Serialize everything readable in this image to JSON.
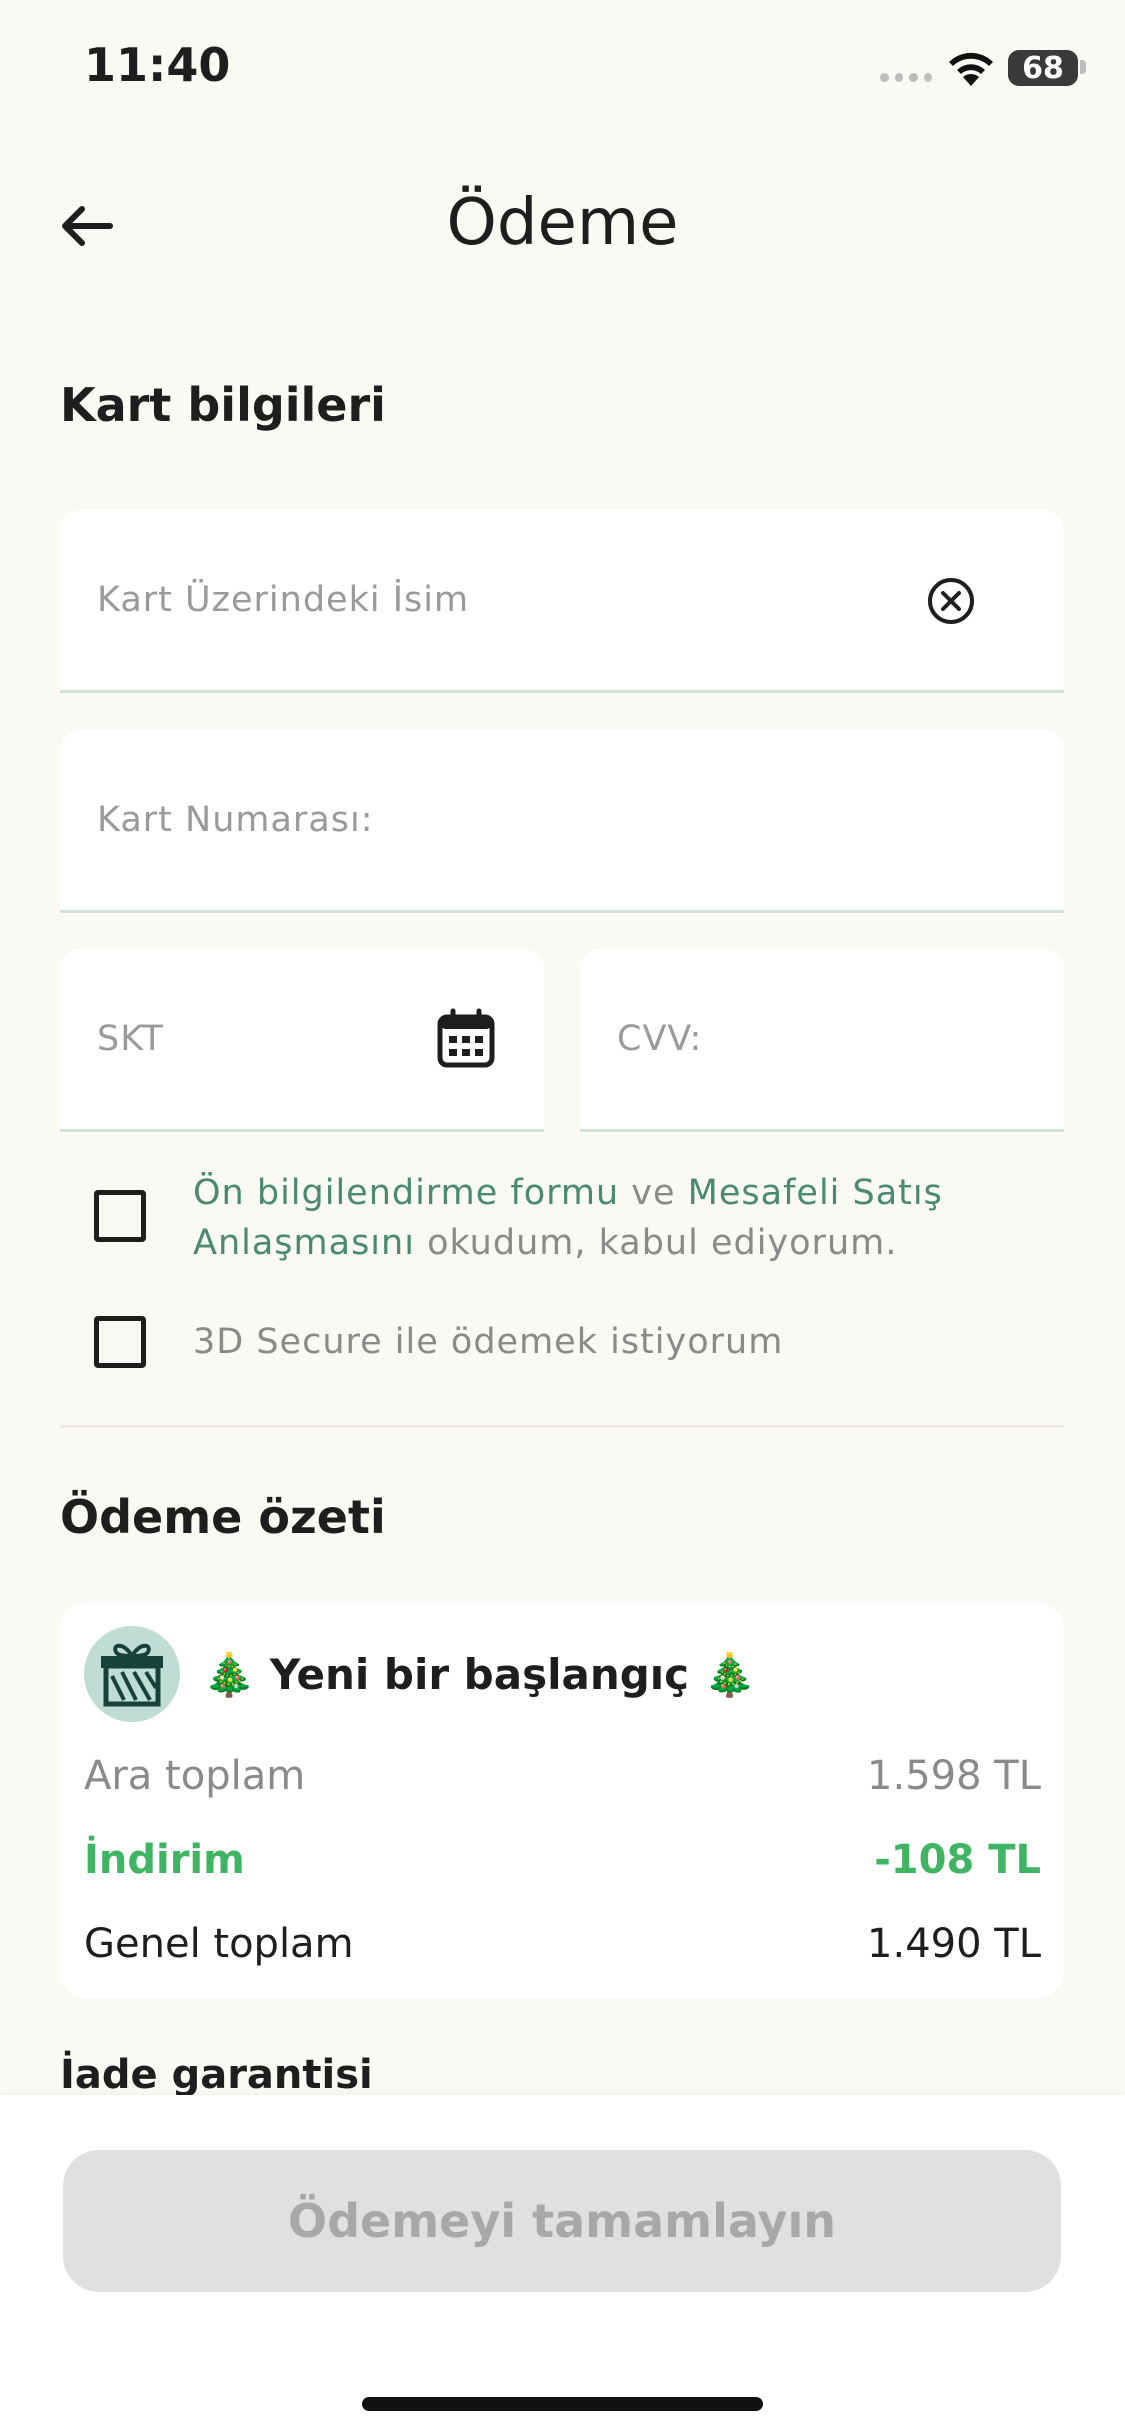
{
  "status": {
    "time": "11:40",
    "battery": "68"
  },
  "header": {
    "title": "Ödeme"
  },
  "card_info": {
    "title": "Kart bilgileri",
    "name_placeholder": "Kart Üzerindeki İsim",
    "number_placeholder": "Kart Numarası:",
    "expiry_placeholder": "SKT",
    "cvv_placeholder": "CVV:"
  },
  "consent": {
    "link1": "Ön bilgilendirme formu",
    "and": " ve ",
    "link2": "Mesafeli Satış Anlaşmasını",
    "rest": " okudum, kabul ediyorum.",
    "secure3d": "3D Secure ile ödemek istiyorum"
  },
  "summary": {
    "title": "Ödeme özeti",
    "promo": "🎄 Yeni bir başlangıç 🎄",
    "subtotal_label": "Ara toplam",
    "subtotal_value": "1.598 TL",
    "discount_label": "İndirim",
    "discount_value": "-108 TL",
    "total_label": "Genel toplam",
    "total_value": "1.490 TL"
  },
  "refund": {
    "title": "İade garantisi"
  },
  "footer": {
    "pay_button": "Ödemeyi tamamlayın"
  },
  "colors": {
    "background": "#FAF9F3",
    "accent_green": "#3FB462",
    "link_green": "#4A8B6B",
    "gift_bg": "#BFDDD5"
  }
}
